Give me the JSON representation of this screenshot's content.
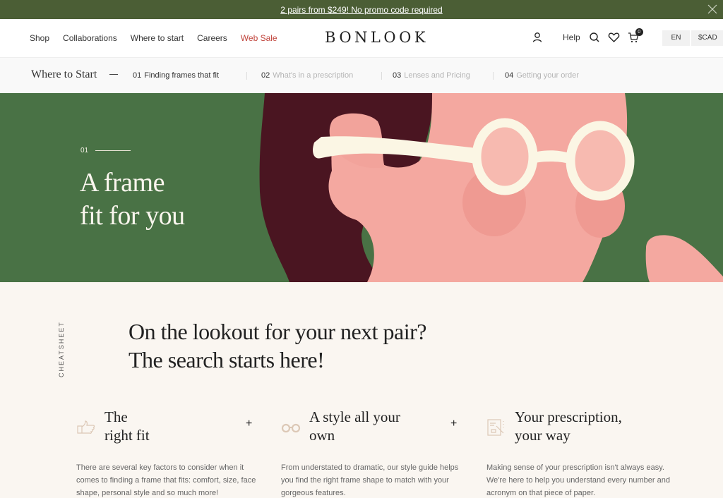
{
  "promo": {
    "text": "2 pairs from $249! No promo code required",
    "close_icon": "close-icon"
  },
  "header": {
    "nav": [
      "Shop",
      "Collaborations",
      "Where to start",
      "Careers",
      "Web Sale"
    ],
    "logo": "BONLOOK",
    "help": "Help",
    "cart_count": "0",
    "language": "EN",
    "currency": "$CAD",
    "icons": [
      "user-icon",
      "search-icon",
      "heart-icon",
      "cart-icon"
    ]
  },
  "subnav": {
    "title": "Where to Start",
    "steps": [
      {
        "num": "01",
        "label": "Finding frames that fit",
        "active": true
      },
      {
        "num": "02",
        "label": "What's in a prescription",
        "active": false
      },
      {
        "num": "03",
        "label": "Lenses and Pricing",
        "active": false
      },
      {
        "num": "04",
        "label": "Getting your order",
        "active": false
      }
    ]
  },
  "hero": {
    "number": "01",
    "title_line1": "A frame",
    "title_line2": "fit for you",
    "colors": {
      "green": "#497245",
      "hair": "#4a1521",
      "skin": "#f4a8a0",
      "glasses": "#fbf6e4"
    }
  },
  "cheatsheet": {
    "side_label": "CHEATSHEET",
    "headline_line1": "On the lookout for your next pair?",
    "headline_line2": "The search starts here!"
  },
  "cards": [
    {
      "icon": "thumbs-up-icon",
      "title_line1": "The",
      "title_line2": "right fit",
      "expand": "+",
      "text": "There are several key factors to consider when it comes to finding a frame that fits: comfort, size, face shape, personal style and so much more!"
    },
    {
      "icon": "glasses-icon",
      "title_line1": "A style all your",
      "title_line2": "own",
      "expand": "+",
      "text": "From understated to dramatic, our style guide helps you find the right frame shape to match with your gorgeous features."
    },
    {
      "icon": "prescription-icon",
      "title_line1": "Your prescription,",
      "title_line2": "your way",
      "expand": "",
      "text": "Making sense of your prescription isn't always easy. We're here to help you understand every number and acronym on that piece of paper."
    }
  ]
}
